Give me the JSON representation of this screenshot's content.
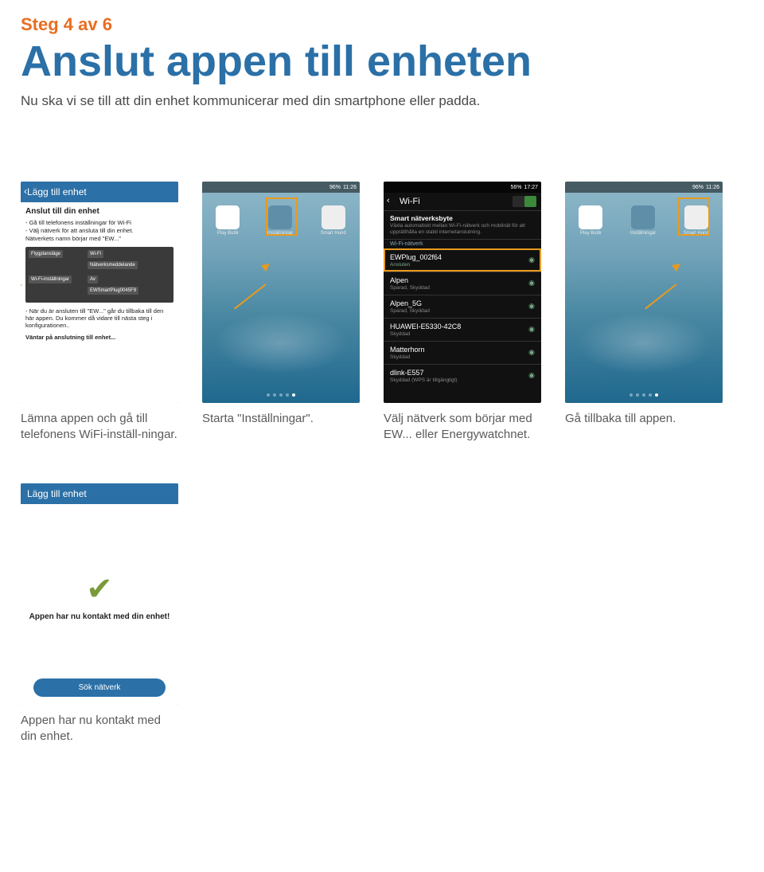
{
  "step": "Steg 4 av 6",
  "title": "Anslut appen till enheten",
  "intro": "Nu ska vi se till att din enhet kommunicerar med din smartphone eller padda.",
  "row1": {
    "s1": {
      "header": "Lägg till enhet",
      "panel_title": "Anslut till din enhet",
      "b1": "- Gå till telefonens inställningar för Wi-Fi",
      "b2": "- Välj nätverk för att ansluta till din enhet.",
      "b3": "  Nätverkets namn börjar med \"EW...\"",
      "t2a": "- När du är ansluten till \"EW...\" går du tillbaka till den här appen. Du kommer då vidare till nästa steg i konfigurationen..",
      "wait": "Väntar på anslutning till enhet...",
      "grey": {
        "a": "Flygplansläge",
        "b": "Wi-Fi",
        "c": "Nätverksmeddelande",
        "d": "Wi-Fi-inställningar",
        "e": "Av",
        "f": "EWSmartPlug0045F9"
      },
      "caption": "Lämna appen och gå till telefonens WiFi-inställ-ningar."
    },
    "s2": {
      "time": "11:26",
      "battery": "96%",
      "icons": {
        "a": "Play Butik",
        "b": "Inställningar",
        "c": "Smart Hund"
      },
      "caption": "Starta \"Inställningar\"."
    },
    "s3": {
      "time": "17:27",
      "battery": "56%",
      "header": "Wi-Fi",
      "switch_title": "Smart nätverksbyte",
      "switch_desc": "Växla automatiskt mellan Wi-Fi-nätverk och mobilnät för att upprätthålla en stabil internetanslutning.",
      "section": "Wi-Fi-nätverk",
      "nets": [
        {
          "name": "EWPlug_002f64",
          "desc": "Ansluten",
          "sel": true
        },
        {
          "name": "Alpen",
          "desc": "Sparad, Skyddad"
        },
        {
          "name": "Alpen_5G",
          "desc": "Sparad, Skyddad"
        },
        {
          "name": "HUAWEI-E5330-42C8",
          "desc": "Skyddad"
        },
        {
          "name": "Matterhorn",
          "desc": "Skyddad"
        },
        {
          "name": "dlink-E557",
          "desc": "Skyddad (WPS är tillgängligt)"
        }
      ],
      "caption": "Välj nätverk som börjar med EW... eller Energywatchnet."
    },
    "s4": {
      "time": "11:26",
      "battery": "96%",
      "icons": {
        "a": "Play Butik",
        "b": "Inställningar",
        "c": "Smart Hund"
      },
      "caption": "Gå tillbaka till appen."
    }
  },
  "row2": {
    "s5": {
      "header": "Lägg till enhet",
      "msg": "Appen har nu kontakt med din enhet!",
      "btn": "Sök nätverk",
      "caption": "Appen har nu kontakt med din enhet."
    }
  }
}
